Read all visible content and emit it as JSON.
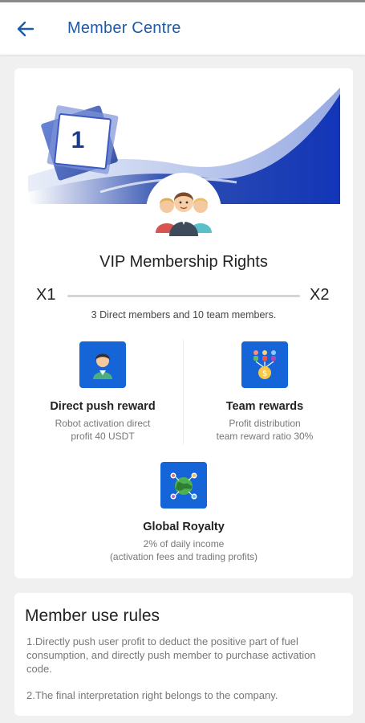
{
  "header": {
    "title": "Member Centre",
    "back_icon": "arrow-left-icon"
  },
  "membership": {
    "level_badge": "1",
    "title": "VIP Membership Rights",
    "current_level": "X1",
    "next_level": "X2",
    "requirement": "3 Direct members and 10 team members."
  },
  "benefits": [
    {
      "title": "Direct push reward",
      "desc_line1": "Robot activation direct",
      "desc_line2": "profit 40 USDT",
      "icon": "user-icon"
    },
    {
      "title": "Team rewards",
      "desc_line1": "Profit distribution",
      "desc_line2": "team reward ratio 30%",
      "icon": "team-coin-icon"
    },
    {
      "title": "Global Royalty",
      "desc_line1": "2% of daily income",
      "desc_line2": "(activation fees and trading profits)",
      "icon": "globe-network-icon"
    }
  ],
  "rules": {
    "title": "Member use rules",
    "items": [
      "1.Directly push user profit to deduct the positive part of fuel consumption, and directly push member to purchase activation code.",
      "2.The final interpretation right belongs to the company."
    ]
  },
  "colors": {
    "accent": "#1565d8",
    "title_blue": "#1e5aa8",
    "page_bg": "#f0f0f0"
  }
}
